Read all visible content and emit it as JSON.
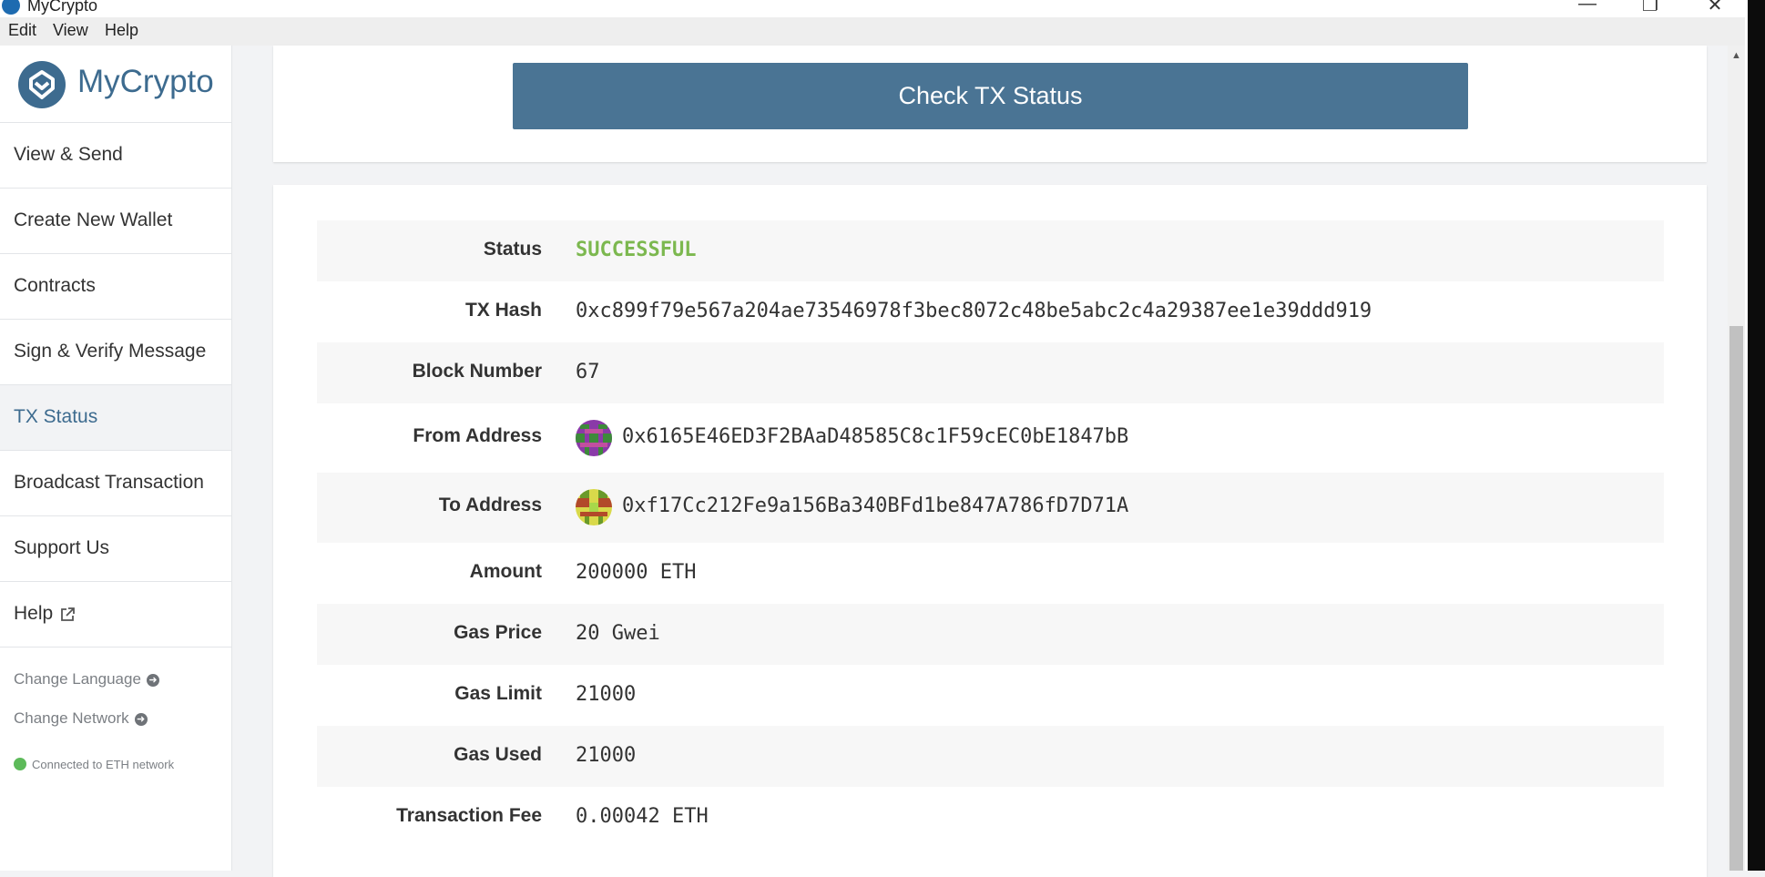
{
  "window": {
    "title": "MyCrypto",
    "minimize_glyph": "—",
    "maximize_glyph": "❐",
    "close_glyph": "✕"
  },
  "menubar": [
    "Edit",
    "View",
    "Help"
  ],
  "brand": {
    "name": "MyCrypto"
  },
  "sidebar": {
    "items": [
      {
        "label": "View & Send"
      },
      {
        "label": "Create New Wallet"
      },
      {
        "label": "Contracts"
      },
      {
        "label": "Sign & Verify Message"
      },
      {
        "label": "TX Status",
        "active": true
      },
      {
        "label": "Broadcast Transaction"
      },
      {
        "label": "Support Us"
      },
      {
        "label": "Help",
        "icon": "external-link-icon"
      }
    ],
    "change_language": "Change Language",
    "change_network": "Change Network",
    "arrow_icon": "arrow-right-circle-icon",
    "network_status": "Connected to ETH network",
    "network_status_color": "#5dba5a"
  },
  "check_button": {
    "label": "Check TX Status",
    "color": "#4a7494"
  },
  "tx": {
    "status": {
      "label": "Status",
      "value": "SUCCESSFUL",
      "color": "#7cb84f"
    },
    "hash": {
      "label": "TX Hash",
      "value": "0xc899f79e567a204ae73546978f3bec8072c48be5abc2c4a29387ee1e39ddd919"
    },
    "block": {
      "label": "Block Number",
      "value": "67"
    },
    "from": {
      "label": "From Address",
      "value": "0x6165E46ED3F2BAaD48585C8c1F59cEC0bE1847bB"
    },
    "to": {
      "label": "To Address",
      "value": "0xf17Cc212Fe9a156Ba340BFd1be847A786fD7D71A"
    },
    "amount": {
      "label": "Amount",
      "value": "200000 ETH"
    },
    "gas_price": {
      "label": "Gas Price",
      "value": "20 Gwei"
    },
    "gas_limit": {
      "label": "Gas Limit",
      "value": "21000"
    },
    "gas_used": {
      "label": "Gas Used",
      "value": "21000"
    },
    "fee": {
      "label": "Transaction Fee",
      "value": "0.00042 ETH"
    }
  }
}
